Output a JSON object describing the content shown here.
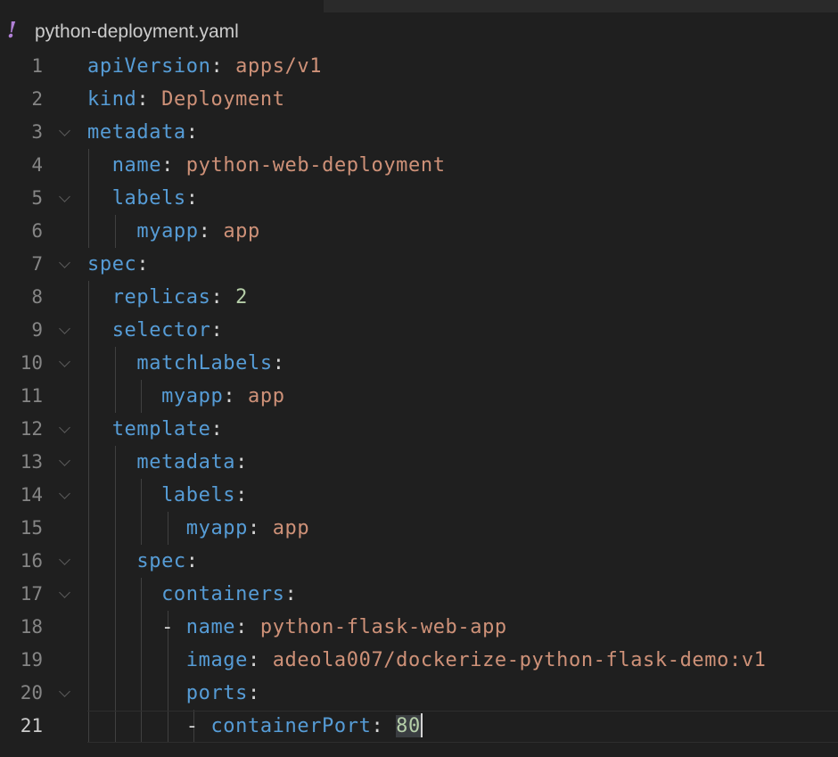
{
  "tab": {
    "icon": "!",
    "filename": "python-deployment.yaml"
  },
  "editor": {
    "lines": [
      {
        "num": "1",
        "indent": "",
        "key": "apiVersion",
        "sep": ": ",
        "value": "apps/v1",
        "vtype": "s"
      },
      {
        "num": "2",
        "indent": "",
        "key": "kind",
        "sep": ": ",
        "value": "Deployment",
        "vtype": "s"
      },
      {
        "num": "3",
        "indent": "",
        "key": "metadata",
        "sep": ":",
        "value": "",
        "vtype": "s"
      },
      {
        "num": "4",
        "indent": "  ",
        "key": "name",
        "sep": ": ",
        "value": "python-web-deployment",
        "vtype": "s"
      },
      {
        "num": "5",
        "indent": "  ",
        "key": "labels",
        "sep": ":",
        "value": "",
        "vtype": "s"
      },
      {
        "num": "6",
        "indent": "    ",
        "key": "myapp",
        "sep": ": ",
        "value": "app",
        "vtype": "s"
      },
      {
        "num": "7",
        "indent": "",
        "key": "spec",
        "sep": ":",
        "value": "",
        "vtype": "s"
      },
      {
        "num": "8",
        "indent": "  ",
        "key": "replicas",
        "sep": ": ",
        "value": "2",
        "vtype": "n"
      },
      {
        "num": "9",
        "indent": "  ",
        "key": "selector",
        "sep": ":",
        "value": "",
        "vtype": "s"
      },
      {
        "num": "10",
        "indent": "    ",
        "key": "matchLabels",
        "sep": ":",
        "value": "",
        "vtype": "s"
      },
      {
        "num": "11",
        "indent": "      ",
        "key": "myapp",
        "sep": ": ",
        "value": "app",
        "vtype": "s"
      },
      {
        "num": "12",
        "indent": "  ",
        "key": "template",
        "sep": ":",
        "value": "",
        "vtype": "s"
      },
      {
        "num": "13",
        "indent": "    ",
        "key": "metadata",
        "sep": ":",
        "value": "",
        "vtype": "s"
      },
      {
        "num": "14",
        "indent": "      ",
        "key": "labels",
        "sep": ":",
        "value": "",
        "vtype": "s"
      },
      {
        "num": "15",
        "indent": "        ",
        "key": "myapp",
        "sep": ": ",
        "value": "app",
        "vtype": "s"
      },
      {
        "num": "16",
        "indent": "    ",
        "key": "spec",
        "sep": ":",
        "value": "",
        "vtype": "s"
      },
      {
        "num": "17",
        "indent": "      ",
        "key": "containers",
        "sep": ":",
        "value": "",
        "vtype": "s"
      },
      {
        "num": "18",
        "indent": "      - ",
        "key": "name",
        "sep": ": ",
        "value": "python-flask-web-app",
        "vtype": "s"
      },
      {
        "num": "19",
        "indent": "        ",
        "key": "image",
        "sep": ": ",
        "value": "adeola007/dockerize-python-flask-demo:v1",
        "vtype": "s"
      },
      {
        "num": "20",
        "indent": "        ",
        "key": "ports",
        "sep": ":",
        "value": "",
        "vtype": "s"
      },
      {
        "num": "21",
        "indent": "        - ",
        "key": "containerPort",
        "sep": ": ",
        "value": "80",
        "vtype": "n"
      }
    ]
  }
}
